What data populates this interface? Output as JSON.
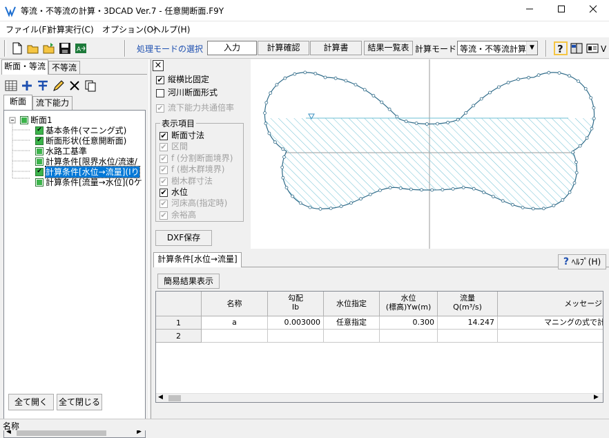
{
  "window": {
    "title": "等流・不等流の計算・3DCAD Ver.7 - 任意開断面.F9Y"
  },
  "menu": [
    "ファイル(F)",
    "計算実行(C)",
    "オプション(O)",
    "ヘルプ(H)"
  ],
  "toolbar": {
    "mode_label": "処理モードの選択",
    "buttons": [
      "入力",
      "計算確認",
      "計算書",
      "結果一覧表"
    ],
    "calc_mode_label": "計算モード",
    "calc_mode_value": "等流・不等流計算"
  },
  "left": {
    "top_tabs": [
      "断面・等流",
      "不等流"
    ],
    "sub_tabs": [
      "断面",
      "流下能力"
    ],
    "tree": {
      "root": "断面1",
      "items": [
        "基本条件(マニング式)",
        "断面形状(任意開断面)",
        "水路工基準",
        "計算条件[限界水位/流速/",
        "計算条件[水位→流量](Iり",
        "計算条件[流量→水位](0ケ"
      ]
    },
    "expand_all": "全て開く",
    "collapse_all": "全て閉じる"
  },
  "options": {
    "close_glyph": "×",
    "fixed_aspect": "縦横比固定",
    "river_section": "河川断面形式",
    "flow_capacity_common": "流下能力共通倍率",
    "group_title": "表示項目",
    "items": [
      {
        "label": "断面寸法",
        "checked": true,
        "enabled": true
      },
      {
        "label": "区間",
        "checked": true,
        "enabled": false
      },
      {
        "label": "f (分割断面境界)",
        "checked": true,
        "enabled": false
      },
      {
        "label": "f (樹木群境界)",
        "checked": true,
        "enabled": false
      },
      {
        "label": "樹木群寸法",
        "checked": true,
        "enabled": false
      },
      {
        "label": "水位",
        "checked": true,
        "enabled": true
      },
      {
        "label": "河床高(指定時)",
        "checked": true,
        "enabled": false
      },
      {
        "label": "余裕高",
        "checked": true,
        "enabled": false
      }
    ],
    "dxf_save": "DXF保存",
    "checkmark": "✔"
  },
  "bottom": {
    "tab": "計算条件[水位→流量]",
    "help": "ﾍﾙﾌﾟ(H)",
    "help_glyph": "?",
    "simple_result": "簡易結果表示",
    "columns": [
      {
        "l1": "名称",
        "l2": ""
      },
      {
        "l1": "勾配",
        "l2": "Ib"
      },
      {
        "l1": "水位指定",
        "l2": ""
      },
      {
        "l1": "水位",
        "l2": "(標高)Yw(m)"
      },
      {
        "l1": "流量",
        "l2": "Q(m³/s)"
      },
      {
        "l1": "メッセージ",
        "l2": ""
      }
    ],
    "rows": [
      {
        "no": "1",
        "name": "a",
        "slope": "0.003000",
        "mode": "任意指定",
        "level": "0.300",
        "flow": "14.247",
        "msg": "マニングの式で計"
      },
      {
        "no": "2",
        "name": "",
        "slope": "",
        "mode": "",
        "level": "",
        "flow": "",
        "msg": ""
      }
    ]
  },
  "status": {
    "text": "名称"
  }
}
